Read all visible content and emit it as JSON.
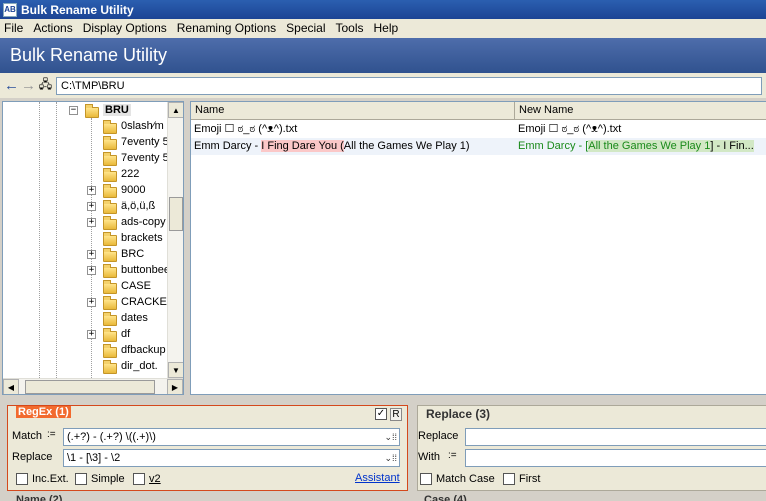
{
  "window": {
    "title": "Bulk Rename Utility",
    "icon": "app-icon",
    "icon_text": "AB"
  },
  "menu": [
    "File",
    "Actions",
    "Display Options",
    "Renaming Options",
    "Special",
    "Tools",
    "Help"
  ],
  "banner": {
    "title": "Bulk Rename Utility"
  },
  "address": {
    "path": "C:\\TMP\\BRU"
  },
  "tree": {
    "items": [
      {
        "label": "BRU",
        "expander": "−",
        "selected": true,
        "level": 0
      },
      {
        "label": "0slash∕m",
        "expander": "",
        "level": 1
      },
      {
        "label": "7eventy 5",
        "expander": "",
        "level": 1
      },
      {
        "label": "7eventy 5",
        "expander": "",
        "level": 1
      },
      {
        "label": "222",
        "expander": "",
        "level": 1
      },
      {
        "label": "9000",
        "expander": "+",
        "level": 1
      },
      {
        "label": "ä,ö,ü,ß",
        "expander": "+",
        "level": 1
      },
      {
        "label": "ads-copy",
        "expander": "+",
        "level": 1
      },
      {
        "label": "brackets",
        "expander": "",
        "level": 1
      },
      {
        "label": "BRC",
        "expander": "+",
        "level": 1
      },
      {
        "label": "buttonbee",
        "expander": "+",
        "level": 1
      },
      {
        "label": "CASE",
        "expander": "",
        "level": 1
      },
      {
        "label": "CRACKET",
        "expander": "+",
        "level": 1
      },
      {
        "label": "dates",
        "expander": "",
        "level": 1
      },
      {
        "label": "df",
        "expander": "+",
        "level": 1
      },
      {
        "label": "dfbackup",
        "expander": "",
        "level": 1
      },
      {
        "label": "dir_dot.",
        "expander": "",
        "level": 1
      }
    ]
  },
  "files": {
    "columns": [
      "Name",
      "New Name"
    ],
    "rows": [
      {
        "name": "Emoji ☐ ಠ_ಠ (^ᴥ^).txt",
        "new_name": "Emoji ☐ ಠ_ಠ (^ᴥ^).txt"
      },
      {
        "name_parts": [
          "Emm Darcy - ",
          "I Fing Dare You (",
          "All the Games We Play 1)"
        ],
        "new_parts": [
          "Emm Darcy - [",
          "All the Games We Play 1",
          "] - I Fin..."
        ]
      }
    ]
  },
  "regex_panel": {
    "title": "RegEx (1)",
    "enabled_check": "✓",
    "r_button": "R",
    "match_label": "Match",
    "match_value": "(.+?) - (.+?) \\((.+)\\)",
    "replace_label": "Replace",
    "replace_value": "\\1 - [\\3] - \\2",
    "inc_ext_label": "Inc.Ext.",
    "simple_label": "Simple",
    "v2_label": "v2",
    "assistant_link": "Assistant"
  },
  "replace_panel": {
    "title": "Replace (3)",
    "replace_label": "Replace",
    "with_label": "With",
    "match_case_label": "Match Case",
    "first_label": "First"
  },
  "bottom_panels": [
    "Name (2)",
    "Case (4)"
  ]
}
